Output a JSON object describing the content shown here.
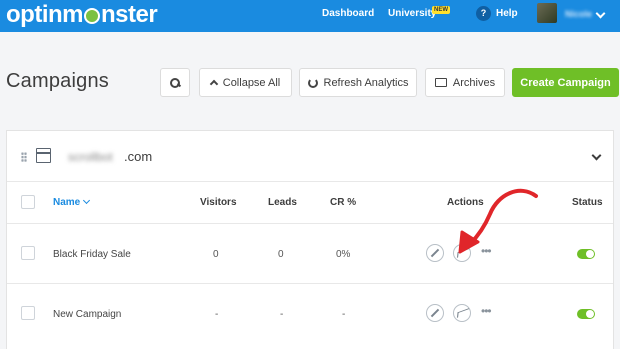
{
  "nav": {
    "logo_left": "optinm",
    "logo_right": "nster",
    "dashboard": "Dashboard",
    "university": "University",
    "new_badge": "NEW",
    "help_glyph": "?",
    "help": "Help",
    "user": "Nicole"
  },
  "page": {
    "title": "Campaigns",
    "collapse_all": "Collapse All",
    "refresh_analytics": "Refresh Analytics",
    "archives": "Archives",
    "create_campaign": "Create Campaign"
  },
  "site": {
    "domain_blurred": "scrollbot",
    "domain_suffix": ".com"
  },
  "table": {
    "columns": {
      "name": "Name",
      "visitors": "Visitors",
      "leads": "Leads",
      "cr": "CR %",
      "actions": "Actions",
      "status": "Status"
    },
    "rows": [
      {
        "name": "Black Friday Sale",
        "visitors": "0",
        "leads": "0",
        "cr": "0%",
        "more": "•••",
        "status_on": true
      },
      {
        "name": "New Campaign",
        "visitors": "-",
        "leads": "-",
        "cr": "-",
        "more": "•••",
        "status_on": true
      }
    ]
  },
  "colors": {
    "brand_blue": "#1a8be0",
    "accent_green": "#6fbf27",
    "annotation_red": "#e0262a"
  }
}
